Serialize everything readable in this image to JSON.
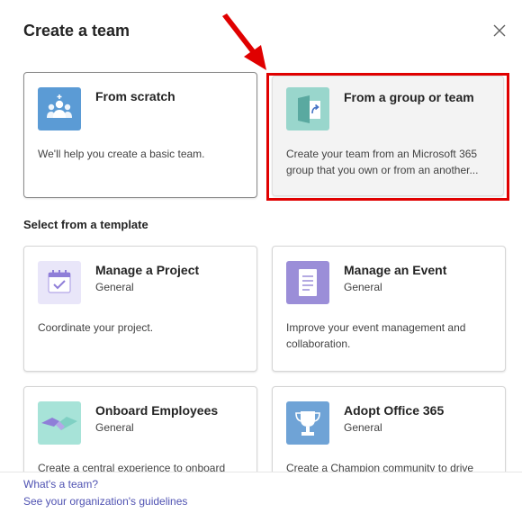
{
  "dialog": {
    "title": "Create a team",
    "close_icon": "close-icon"
  },
  "options": [
    {
      "title": "From scratch",
      "description": "We'll help you create a basic team.",
      "icon": "people-group-icon",
      "tile_color": "#5b9bd5"
    },
    {
      "title": "From a group or team",
      "description": "Create your team from an Microsoft 365 group that you own or from an another...",
      "icon": "group-arrow-icon",
      "tile_color": "#99d6cc"
    }
  ],
  "template_section": {
    "label": "Select from a template",
    "templates": [
      {
        "title": "Manage a Project",
        "subtitle": "General",
        "description": "Coordinate your project.",
        "icon": "calendar-check-icon",
        "tile_color": "#e9e6f9"
      },
      {
        "title": "Manage an Event",
        "subtitle": "General",
        "description": "Improve your event management and collaboration.",
        "icon": "clipboard-list-icon",
        "tile_color": "#9b8ed8"
      },
      {
        "title": "Onboard Employees",
        "subtitle": "General",
        "description": "Create a central experience to onboard",
        "icon": "handshake-icon",
        "tile_color": "#a7e3d8"
      },
      {
        "title": "Adopt Office 365",
        "subtitle": "General",
        "description": "Create a Champion community to drive",
        "icon": "trophy-icon",
        "tile_color": "#6fa3d6"
      }
    ]
  },
  "footer": {
    "whats_a_team": "What's a team?",
    "guidelines": "See your organization's guidelines"
  },
  "colors": {
    "highlight": "#e00000",
    "link": "#4f52b2"
  }
}
